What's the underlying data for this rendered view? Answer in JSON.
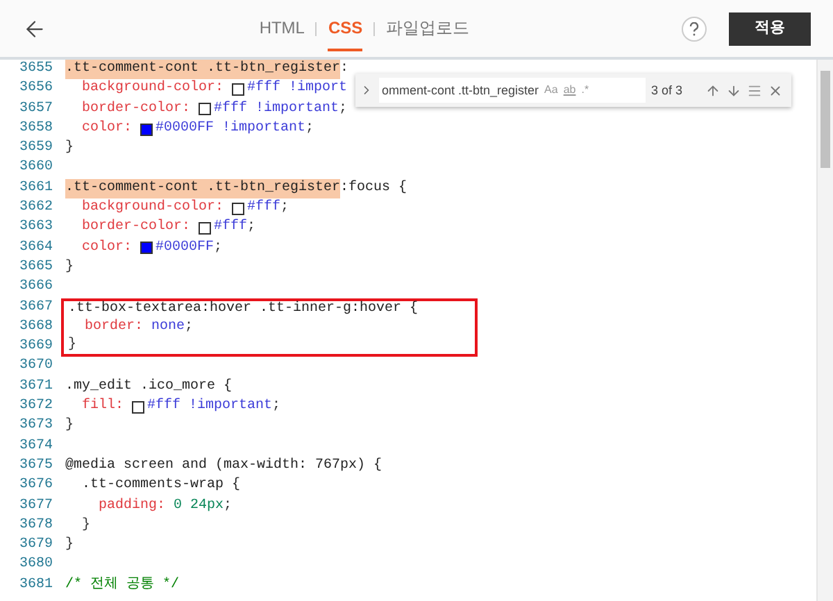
{
  "tabs": [
    {
      "label": "HTML",
      "selected": false
    },
    {
      "label": "CSS",
      "selected": true
    },
    {
      "label": "파일업로드",
      "selected": false
    }
  ],
  "apply_button": "적용",
  "find": {
    "value": "omment-cont .tt-btn_register",
    "options": [
      "Aa",
      "ab",
      ".*"
    ],
    "count": "3 of 3"
  },
  "lines": [
    {
      "num": "3655",
      "boxed": false,
      "tokens": [
        {
          "kind": "selector",
          "text": ".tt-comment-cont .tt-btn_register",
          "match": true
        },
        {
          "kind": "punct",
          "text": ":"
        }
      ]
    },
    {
      "num": "3656",
      "boxed": false,
      "tokens": [
        {
          "kind": "prop",
          "text": "  background-color: "
        },
        {
          "kind": "swatch",
          "color": "#ffffff"
        },
        {
          "kind": "value",
          "text": "#fff !import"
        }
      ]
    },
    {
      "num": "3657",
      "boxed": false,
      "tokens": [
        {
          "kind": "prop",
          "text": "  border-color: "
        },
        {
          "kind": "swatch",
          "color": "#ffffff"
        },
        {
          "kind": "value",
          "text": "#fff !important"
        },
        {
          "kind": "punct",
          "text": ";"
        }
      ]
    },
    {
      "num": "3658",
      "boxed": false,
      "tokens": [
        {
          "kind": "prop",
          "text": "  color: "
        },
        {
          "kind": "swatch",
          "color": "#0000ff"
        },
        {
          "kind": "value",
          "text": "#0000FF !important"
        },
        {
          "kind": "punct",
          "text": ";"
        }
      ]
    },
    {
      "num": "3659",
      "boxed": false,
      "tokens": [
        {
          "kind": "punct",
          "text": "}"
        }
      ]
    },
    {
      "num": "3660",
      "boxed": false
    },
    {
      "num": "3661",
      "boxed": false,
      "tokens": [
        {
          "kind": "selector",
          "text": ".tt-comment-cont .tt-btn_register",
          "match": true
        },
        {
          "kind": "selector",
          "text": ":focus {"
        }
      ]
    },
    {
      "num": "3662",
      "boxed": false,
      "tokens": [
        {
          "kind": "prop",
          "text": "  background-color: "
        },
        {
          "kind": "swatch",
          "color": "#ffffff"
        },
        {
          "kind": "value",
          "text": "#fff"
        },
        {
          "kind": "punct",
          "text": ";"
        }
      ]
    },
    {
      "num": "3663",
      "boxed": false,
      "tokens": [
        {
          "kind": "prop",
          "text": "  border-color: "
        },
        {
          "kind": "swatch",
          "color": "#ffffff"
        },
        {
          "kind": "value",
          "text": "#fff"
        },
        {
          "kind": "punct",
          "text": ";"
        }
      ]
    },
    {
      "num": "3664",
      "boxed": false,
      "tokens": [
        {
          "kind": "prop",
          "text": "  color: "
        },
        {
          "kind": "swatch",
          "color": "#0000ff"
        },
        {
          "kind": "value",
          "text": "#0000FF"
        },
        {
          "kind": "punct",
          "text": ";"
        }
      ]
    },
    {
      "num": "3665",
      "boxed": false,
      "tokens": [
        {
          "kind": "punct",
          "text": "}"
        }
      ]
    },
    {
      "num": "3666",
      "boxed": false
    },
    {
      "num": "3667",
      "boxed": true,
      "tokens": [
        {
          "kind": "selector",
          "text": ".tt-box-textarea:hover .tt-inner-g:hover {"
        }
      ]
    },
    {
      "num": "3668",
      "boxed": true,
      "tokens": [
        {
          "kind": "prop",
          "text": "  border: "
        },
        {
          "kind": "value",
          "text": "none"
        },
        {
          "kind": "punct",
          "text": ";"
        }
      ]
    },
    {
      "num": "3669",
      "boxed": true,
      "tokens": [
        {
          "kind": "punct",
          "text": "}"
        }
      ]
    },
    {
      "num": "3670",
      "boxed": false
    },
    {
      "num": "3671",
      "boxed": false,
      "tokens": [
        {
          "kind": "selector",
          "text": ".my_edit .ico_more {"
        }
      ]
    },
    {
      "num": "3672",
      "boxed": false,
      "tokens": [
        {
          "kind": "prop",
          "text": "  fill: "
        },
        {
          "kind": "swatch",
          "color": "#ffffff"
        },
        {
          "kind": "value",
          "text": "#fff !important"
        },
        {
          "kind": "punct",
          "text": ";"
        }
      ]
    },
    {
      "num": "3673",
      "boxed": false,
      "tokens": [
        {
          "kind": "punct",
          "text": "}"
        }
      ]
    },
    {
      "num": "3674",
      "boxed": false
    },
    {
      "num": "3675",
      "boxed": false,
      "tokens": [
        {
          "kind": "selector",
          "text": "@media screen and (max-width: 767px) {"
        }
      ]
    },
    {
      "num": "3676",
      "boxed": false,
      "tokens": [
        {
          "kind": "selector",
          "text": "  .tt-comments-wrap {"
        }
      ]
    },
    {
      "num": "3677",
      "boxed": false,
      "tokens": [
        {
          "kind": "prop",
          "text": "    padding: "
        },
        {
          "kind": "number",
          "text": "0 24px"
        },
        {
          "kind": "punct",
          "text": ";"
        }
      ]
    },
    {
      "num": "3678",
      "boxed": false,
      "tokens": [
        {
          "kind": "punct",
          "text": "  }"
        }
      ]
    },
    {
      "num": "3679",
      "boxed": false,
      "tokens": [
        {
          "kind": "punct",
          "text": "}"
        }
      ]
    },
    {
      "num": "3680",
      "boxed": false
    },
    {
      "num": "3681",
      "boxed": false,
      "tokens": [
        {
          "kind": "comment",
          "text": "/* 전체 공통 */"
        }
      ]
    }
  ]
}
